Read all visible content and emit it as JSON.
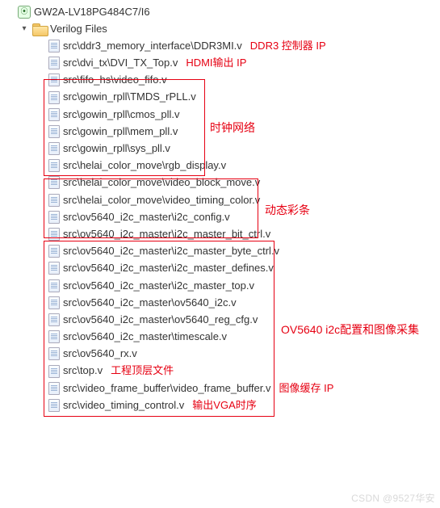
{
  "root": {
    "label": "GW2A-LV18PG484C7/I6"
  },
  "folder": {
    "label": "Verilog Files"
  },
  "files": {
    "f0": "src\\ddr3_memory_interface\\DDR3MI.v",
    "f1": "src\\dvi_tx\\DVI_TX_Top.v",
    "f2": "src\\fifo_hs\\video_fifo.v",
    "f3": "src\\gowin_rpll\\TMDS_rPLL.v",
    "f4": "src\\gowin_rpll\\cmos_pll.v",
    "f5": "src\\gowin_rpll\\mem_pll.v",
    "f6": "src\\gowin_rpll\\sys_pll.v",
    "f7": "src\\helai_color_move\\rgb_display.v",
    "f8": "src\\helai_color_move\\video_block_move.v",
    "f9": "src\\helai_color_move\\video_timing_color.v",
    "f10": "src\\ov5640_i2c_master\\i2c_config.v",
    "f11": "src\\ov5640_i2c_master\\i2c_master_bit_ctrl.v",
    "f12": "src\\ov5640_i2c_master\\i2c_master_byte_ctrl.v",
    "f13": "src\\ov5640_i2c_master\\i2c_master_defines.v",
    "f14": "src\\ov5640_i2c_master\\i2c_master_top.v",
    "f15": "src\\ov5640_i2c_master\\ov5640_i2c.v",
    "f16": "src\\ov5640_i2c_master\\ov5640_reg_cfg.v",
    "f17": "src\\ov5640_i2c_master\\timescale.v",
    "f18": "src\\ov5640_rx.v",
    "f19": "src\\top.v",
    "f20": "src\\video_frame_buffer\\video_frame_buffer.v",
    "f21": "src\\video_timing_control.v"
  },
  "annotations": {
    "ddr3": "DDR3 控制器 IP",
    "hdmi": "HDMI输出 IP",
    "clknet": "时钟网络",
    "dync": "动态彩条",
    "ov5640": "OV5640 i2c配置和图像采集",
    "top": "工程顶层文件",
    "fb": "图像缓存 IP",
    "vga": "输出VGA时序"
  },
  "watermark": "CSDN @9527华安"
}
